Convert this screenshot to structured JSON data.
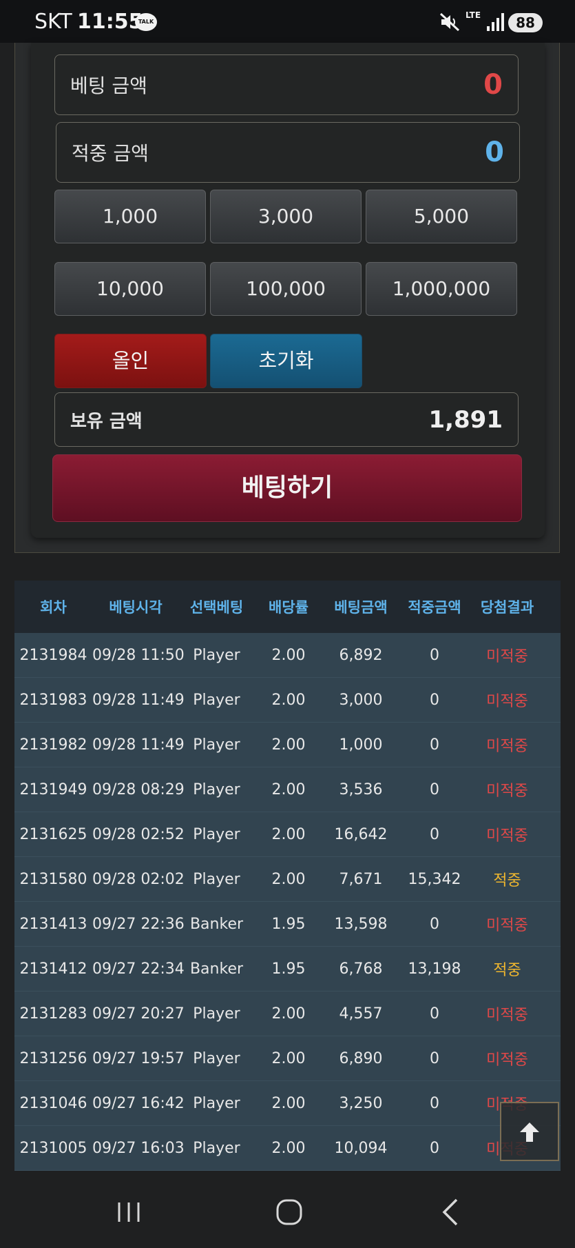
{
  "status_bar": {
    "carrier": "SKT",
    "time": "11:55",
    "talk": "TALK",
    "lte": "LTE",
    "battery": "88"
  },
  "bet_form": {
    "bet_amount_label": "베팅 금액",
    "bet_amount_value": "0",
    "win_amount_label": "적중 금액",
    "win_amount_value": "0",
    "chips": [
      "1,000",
      "3,000",
      "5,000",
      "10,000",
      "100,000",
      "1,000,000"
    ],
    "all_in_label": "올인",
    "reset_label": "초기화",
    "balance_label": "보유 금액",
    "balance_value": "1,891",
    "bet_button_label": "베팅하기",
    "colors": {
      "bet_amount": "#e04848",
      "win_amount": "#5fb3ea"
    }
  },
  "history": {
    "headers": [
      "회차",
      "베팅시각",
      "선택베팅",
      "배당률",
      "베팅금액",
      "적중금액",
      "당첨결과"
    ],
    "rows": [
      [
        "2131984",
        "09/28 11:50",
        "Player",
        "2.00",
        "6,892",
        "0",
        "미적중"
      ],
      [
        "2131983",
        "09/28 11:49",
        "Player",
        "2.00",
        "3,000",
        "0",
        "미적중"
      ],
      [
        "2131982",
        "09/28 11:49",
        "Player",
        "2.00",
        "1,000",
        "0",
        "미적중"
      ],
      [
        "2131949",
        "09/28 08:29",
        "Player",
        "2.00",
        "3,536",
        "0",
        "미적중"
      ],
      [
        "2131625",
        "09/28 02:52",
        "Player",
        "2.00",
        "16,642",
        "0",
        "미적중"
      ],
      [
        "2131580",
        "09/28 02:02",
        "Player",
        "2.00",
        "7,671",
        "15,342",
        "적중"
      ],
      [
        "2131413",
        "09/27 22:36",
        "Banker",
        "1.95",
        "13,598",
        "0",
        "미적중"
      ],
      [
        "2131412",
        "09/27 22:34",
        "Banker",
        "1.95",
        "6,768",
        "13,198",
        "적중"
      ],
      [
        "2131283",
        "09/27 20:27",
        "Player",
        "2.00",
        "4,557",
        "0",
        "미적중"
      ],
      [
        "2131256",
        "09/27 19:57",
        "Player",
        "2.00",
        "6,890",
        "0",
        "미적중"
      ],
      [
        "2131046",
        "09/27 16:42",
        "Player",
        "2.00",
        "3,250",
        "0",
        "미적중"
      ],
      [
        "2131005",
        "09/27 16:03",
        "Player",
        "2.00",
        "10,094",
        "0",
        "미적중"
      ]
    ],
    "win_result": "적중"
  },
  "scroll_top_icon": "arrow-up-icon",
  "nav_icons": [
    "recent-apps-icon",
    "home-icon",
    "back-icon"
  ]
}
